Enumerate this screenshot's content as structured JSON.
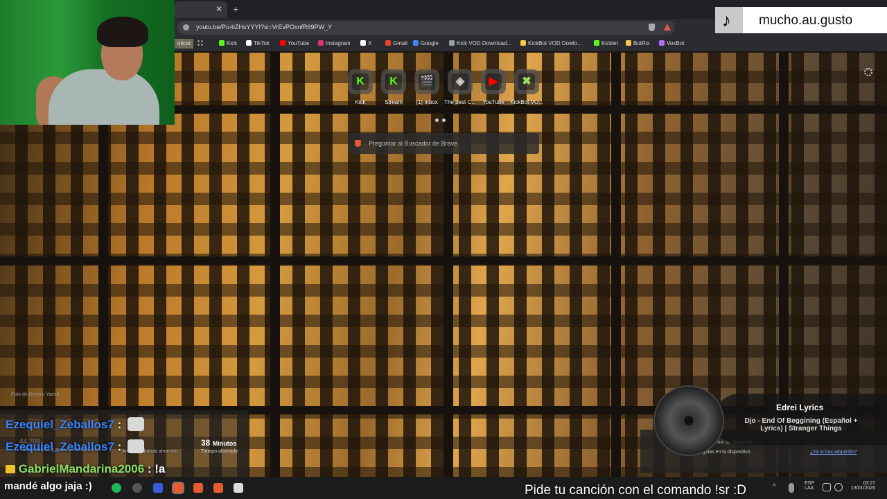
{
  "browser": {
    "url": "youtu.be/Pu-bZHsYYYI?si=VrEvPOxnfR69PW_Y",
    "bookmarks_partial": "olicar",
    "bookmarks": [
      {
        "label": "Kick",
        "color": "#53fc18"
      },
      {
        "label": "TikTok",
        "color": "#ffffff"
      },
      {
        "label": "YouTube",
        "color": "#ff0000"
      },
      {
        "label": "Instagram",
        "color": "#e1306c"
      },
      {
        "label": "X",
        "color": "#ffffff"
      },
      {
        "label": "Gmail",
        "color": "#ea4335"
      },
      {
        "label": "Google",
        "color": "#4285f4"
      },
      {
        "label": "Kick VOD Download...",
        "color": "#9aa0a6"
      },
      {
        "label": "KickBot VOD Dowlo...",
        "color": "#f2c94c"
      },
      {
        "label": "Kicklet",
        "color": "#53fc18"
      },
      {
        "label": "BotRix",
        "color": "#f2c94c"
      },
      {
        "label": "VoxBot",
        "color": "#b36bff"
      }
    ]
  },
  "newtab": {
    "speed_dial": [
      {
        "label": "Kick",
        "glyph": "K",
        "color": "#53fc18"
      },
      {
        "label": "Stream",
        "glyph": "K",
        "color": "#53fc18"
      },
      {
        "label": "(1) Inbox",
        "glyph": "🎬",
        "color": "#f2c94c"
      },
      {
        "label": "The best C...",
        "glyph": "◈",
        "color": "#cccccc"
      },
      {
        "label": "YouTube",
        "glyph": "▶",
        "color": "#ff0000"
      },
      {
        "label": "KickBot VO...",
        "glyph": "✖",
        "color": "#9be15d"
      }
    ],
    "search_placeholder": "Preguntar al Buscador de Brave",
    "photo_credit": "Foto de Dmytro Yarish"
  },
  "tiktok": {
    "username": "mucho.au.gusto"
  },
  "chat": {
    "messages": [
      {
        "user": "Ezequiel_Zeballos7",
        "text": ":"
      },
      {
        "user": "Ezequiel_Zeballos7",
        "text": ":"
      },
      {
        "user": "GabrielMandarina2006",
        "text": ": !a"
      }
    ],
    "continuation": "mandé algo jaja :)"
  },
  "stats": {
    "minutes_value": "38",
    "minutes_unit": "Minutos",
    "minutes_label": "Tiempo ahorrado",
    "blocked_value": "44.709",
    "blocked_label": "Rastreadores y anuncios bloqueados",
    "bandwidth_label": "Ancho de banda ahorrado"
  },
  "now_playing": {
    "channel": "Edrei Lyrics",
    "song": "Djo - End Of Beggining (Español + Lyrics) | Stranger Things"
  },
  "popup": {
    "line1": "...ambie su ubicación",
    "line2": "Apps protegidas en tu dispositivo",
    "link": "¿Ya lo has adquirido?"
  },
  "caption": "Pide tu canción con el comando !sr :D",
  "tray": {
    "lang1": "ESP",
    "lang2": "LAA",
    "time": "03:27",
    "date": "13/01/2026"
  }
}
